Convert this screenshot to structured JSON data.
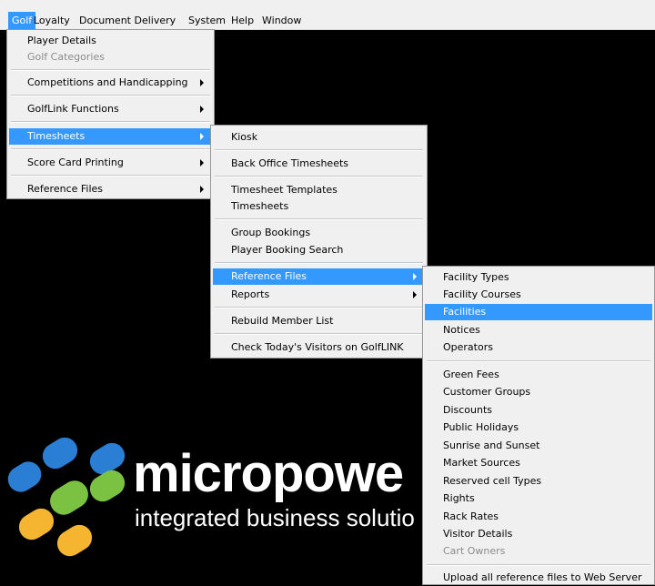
{
  "menubar": {
    "items": [
      "Golf",
      "Loyalty",
      "Document Delivery",
      "System",
      "Help",
      "Window"
    ]
  },
  "golf_menu": {
    "items": [
      {
        "label": "Player Details"
      },
      {
        "label": "Golf Categories",
        "disabled": true
      },
      {
        "label": "Competitions and Handicapping",
        "submenu": true
      },
      {
        "label": "GolfLink Functions",
        "submenu": true
      },
      {
        "label": "Timesheets",
        "submenu": true,
        "highlighted": true
      },
      {
        "label": "Score Card Printing",
        "submenu": true
      },
      {
        "label": "Reference Files",
        "submenu": true
      }
    ]
  },
  "timesheets_menu": {
    "items": [
      {
        "label": "Kiosk"
      },
      {
        "label": "Back Office Timesheets"
      },
      {
        "label": "Timesheet Templates"
      },
      {
        "label": "Timesheets"
      },
      {
        "label": "Group Bookings"
      },
      {
        "label": "Player Booking Search"
      },
      {
        "label": "Reference Files",
        "submenu": true,
        "highlighted": true
      },
      {
        "label": "Reports",
        "submenu": true
      },
      {
        "label": "Rebuild Member List"
      },
      {
        "label": "Check Today's Visitors on GolfLINK"
      }
    ]
  },
  "reference_menu": {
    "items": [
      {
        "label": "Facility Types"
      },
      {
        "label": "Facility Courses"
      },
      {
        "label": "Facilities",
        "highlighted": true
      },
      {
        "label": "Notices"
      },
      {
        "label": "Operators"
      },
      {
        "label": "Green Fees"
      },
      {
        "label": "Customer Groups"
      },
      {
        "label": "Discounts"
      },
      {
        "label": "Public Holidays"
      },
      {
        "label": "Sunrise and Sunset"
      },
      {
        "label": "Market Sources"
      },
      {
        "label": "Reserved cell Types"
      },
      {
        "label": "Rights"
      },
      {
        "label": "Rack Rates"
      },
      {
        "label": "Visitor Details"
      },
      {
        "label": "Cart Owners",
        "disabled": true
      },
      {
        "label": "Upload all reference files to Web Server"
      }
    ]
  },
  "branding": {
    "name": "micropowe",
    "tagline": "integrated business solutio"
  },
  "colors": {
    "highlight": "#3399ff",
    "logo_blue": "#2a7fd4",
    "logo_green": "#7cc242",
    "logo_yellow": "#f6b531",
    "background": "#000000"
  }
}
